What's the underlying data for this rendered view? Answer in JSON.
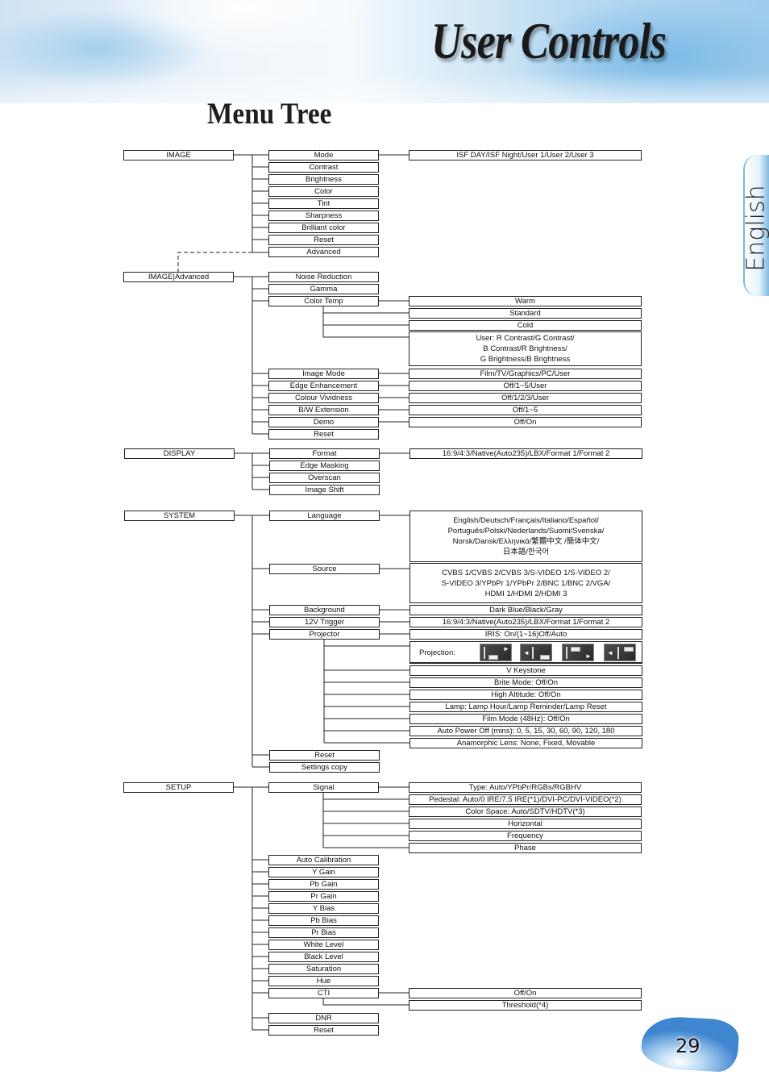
{
  "header": {
    "section_title": "User Controls",
    "page_heading": "Menu Tree",
    "language_tab": "English",
    "page_number": "29"
  },
  "menu_tree": {
    "image": {
      "label": "IMAGE",
      "items": [
        "Mode",
        "Contrast",
        "Brightness",
        "Color",
        "Tint",
        "Sharpness",
        "Brilliant color",
        "Reset",
        "Advanced"
      ],
      "mode_options": "ISF DAY/ISF Night/User 1/User 2/User 3"
    },
    "image_advanced": {
      "label": "IMAGE|Advanced",
      "items": [
        "Noise Reduction",
        "Gamma",
        "Color Temp",
        "Image Mode",
        "Edge Enhancement",
        "Colour Vividness",
        "B/W Extension",
        "Demo",
        "Reset"
      ],
      "color_temp_options": [
        "Warm",
        "Standard",
        "Cold"
      ],
      "color_temp_user": [
        "User: R Contrast/G Contrast/",
        "B Contrast/R Brightness/",
        "G Brightness/B Brightness"
      ],
      "image_mode_options": "Film/TV/Graphics/PC/User",
      "edge_enhancement_options": "Off/1~5/User",
      "colour_vividness_options": "Off/1/2/3/User",
      "bw_extension_options": "Off/1~5",
      "demo_options": "Off/On"
    },
    "display": {
      "label": "DISPLAY",
      "items": [
        "Format",
        "Edge Masking",
        "Overscan",
        "Image Shift"
      ],
      "format_options": "16:9/4:3/Native(Auto235)/LBX/Format 1/Format 2"
    },
    "system": {
      "label": "SYSTEM",
      "items": [
        "Language",
        "Source",
        "Background",
        "12V Trigger",
        "Projector",
        "Reset",
        "Settings copy"
      ],
      "language_options": [
        "English/Deutsch/Français/Italiano/Español/",
        "Português/Polski/Nederlands/Suomi/Svenska/",
        "Norsk/Dansk/Ελληνικά/繁體中文 /簡体中文/",
        "日本語/한국어"
      ],
      "source_options": [
        "CVBS 1/CVBS 2/CVBS 3/S-VIDEO 1/S-VIDEO 2/",
        "S-VIDEO 3/YPbPr 1/YPbPr 2/BNC 1/BNC 2/VGA/",
        "HDMI 1/HDMI 2/HDMI 3"
      ],
      "background_options": "Dark Blue/Black/Gray",
      "trigger_options": "16:9/4:3/Native(Auto235)/LBX/Format 1/Format 2",
      "projector_options": [
        "IRIS: On/(1~16)Off/Auto",
        "V Keystone",
        "Brite Mode: Off/On",
        "High Altitude: Off/On",
        "Lamp: Lamp Hour/Lamp Reminder/Lamp Reset",
        "Film Mode (48Hz): Off/On",
        "Auto Power Off (mins): 0, 5, 15, 30, 60, 90, 120, 180",
        "Anamorphic Lens: None, Fixed, Movable"
      ],
      "projection_label": "Projection:",
      "projection_icons": [
        "front-desktop-icon",
        "rear-desktop-icon",
        "front-ceiling-icon",
        "rear-ceiling-icon"
      ]
    },
    "setup": {
      "label": "SETUP",
      "items": [
        "Signal",
        "Auto Calibration",
        "Y Gain",
        "Pb Gain",
        "Pr Gain",
        "Y Bias",
        "Pb Bias",
        "Pr Bias",
        "White Level",
        "Black Level",
        "Saturation",
        "Hue",
        "CTI",
        "DNR",
        "Reset"
      ],
      "signal_options": [
        "Type: Auto/YPbPr/RGBs/RGBHV",
        "Pedestal: Auto/0 IRE/7.5 IRE(*1)/DVI-PC/DVI-VIDEO(*2)",
        "Color Space: Auto/SDTV/HDTV(*3)",
        "Horizontal",
        "Frequency",
        "Phase"
      ],
      "cti_options": [
        "Off/On",
        "Threshold(*4)"
      ]
    }
  }
}
